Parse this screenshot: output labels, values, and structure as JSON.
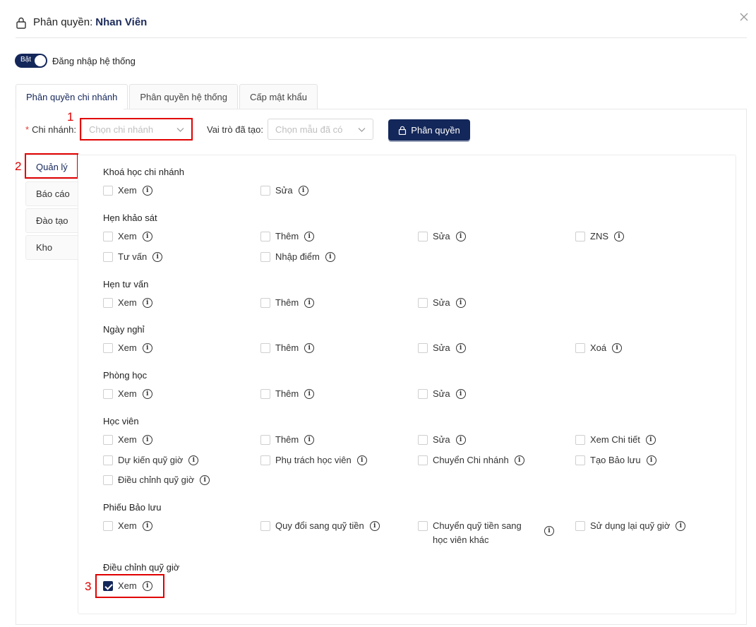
{
  "header": {
    "title": "Phân quyền:",
    "user_name": "Nhan Viên"
  },
  "toggle": {
    "state": "Bật",
    "label": "Đăng nhập hệ thống"
  },
  "tabs": [
    {
      "label": "Phân quyền chi nhánh"
    },
    {
      "label": "Phân quyền hệ thống"
    },
    {
      "label": "Cấp mật khẩu"
    }
  ],
  "filters": {
    "required_mark": "*",
    "branch_label": "Chi nhánh:",
    "branch_placeholder": "Chọn chi nhánh",
    "role_label": "Vai trò đã tạo:",
    "role_placeholder": "Chọn mẫu đã có",
    "submit_label": "Phân quyền"
  },
  "annotations": [
    "1",
    "2",
    "3"
  ],
  "sidebar": [
    {
      "label": "Quản lý"
    },
    {
      "label": "Báo cáo"
    },
    {
      "label": "Đào tạo"
    },
    {
      "label": "Kho"
    }
  ],
  "sections": [
    {
      "title": "Khoá học chi nhánh",
      "items": [
        {
          "label": "Xem"
        },
        {
          "label": "Sửa"
        }
      ]
    },
    {
      "title": "Hẹn khảo sát",
      "items": [
        {
          "label": "Xem"
        },
        {
          "label": "Thêm"
        },
        {
          "label": "Sửa"
        },
        {
          "label": "ZNS"
        },
        {
          "label": "Tư vấn"
        },
        {
          "label": "Nhập điểm"
        }
      ]
    },
    {
      "title": "Hẹn tư vấn",
      "items": [
        {
          "label": "Xem"
        },
        {
          "label": "Thêm"
        },
        {
          "label": "Sửa"
        }
      ]
    },
    {
      "title": "Ngày nghỉ",
      "items": [
        {
          "label": "Xem"
        },
        {
          "label": "Thêm"
        },
        {
          "label": "Sửa"
        },
        {
          "label": "Xoá"
        }
      ]
    },
    {
      "title": "Phòng học",
      "items": [
        {
          "label": "Xem"
        },
        {
          "label": "Thêm"
        },
        {
          "label": "Sửa"
        }
      ]
    },
    {
      "title": "Học viên",
      "items": [
        {
          "label": "Xem"
        },
        {
          "label": "Thêm"
        },
        {
          "label": "Sửa"
        },
        {
          "label": "Xem Chi tiết"
        },
        {
          "label": "Dự kiến quỹ giờ"
        },
        {
          "label": "Phụ trách học viên"
        },
        {
          "label": "Chuyển Chi nhánh"
        },
        {
          "label": "Tạo Bảo lưu"
        },
        {
          "label": "Điều chỉnh quỹ giờ"
        }
      ]
    },
    {
      "title": "Phiếu Bảo lưu",
      "items": [
        {
          "label": "Xem"
        },
        {
          "label": "Quy đổi sang quỹ tiền"
        },
        {
          "label": "Chuyển quỹ tiền sang học viên khác"
        },
        {
          "label": "Sử dụng lại quỹ giờ"
        }
      ]
    },
    {
      "title": "Điều chỉnh quỹ giờ",
      "items": [
        {
          "label": "Xem",
          "checked": true
        }
      ]
    }
  ]
}
